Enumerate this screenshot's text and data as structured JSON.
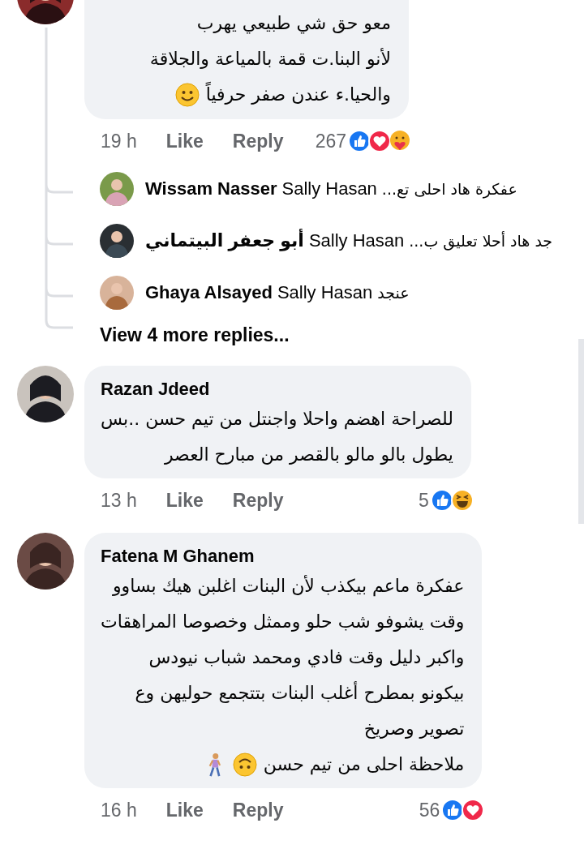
{
  "comments": [
    {
      "lines": [
        "معو حق شي طبيعي يهرب",
        "لأنو البنا.ت قمة بالمياعة والجلاقة",
        "والحيا.ء عندن صفر حرفياً"
      ],
      "emoji": [
        {
          "kind": "smile"
        }
      ],
      "time": "19 h",
      "like": "Like",
      "reply": "Reply",
      "reaction_count": "267",
      "reactions": [
        {
          "kind": "like"
        },
        {
          "kind": "love"
        },
        {
          "kind": "care"
        }
      ],
      "replies": [
        {
          "name": "Wissam Nasser",
          "mention": "Sally Hasan",
          "text": "عفكرة هاد احلى تع..."
        },
        {
          "name": "أبو جعفر البيتماني",
          "mention": "Sally Hasan",
          "text": "جد هاد أحلا تعليق ب..."
        },
        {
          "name": "Ghaya Alsayed",
          "mention": "Sally Hasan",
          "text": "عنجد"
        }
      ],
      "more_replies": "View 4 more replies..."
    },
    {
      "name": "Razan Jdeed",
      "lines": [
        "للصراحة اهضم واحلا واجنتل من تيم حسن ..بس",
        "يطول بالو مالو بالقصر من مبارح العصر"
      ],
      "time": "13 h",
      "like": "Like",
      "reply": "Reply",
      "reaction_count": "5",
      "reactions": [
        {
          "kind": "like"
        },
        {
          "kind": "haha"
        }
      ]
    },
    {
      "name": "Fatena M Ghanem",
      "lines": [
        "عفكرة ماعم بيكذب لأن البنات اغلبن هيك بساوو",
        "وقت يشوفو شب حلو وممثل وخصوصا المراهقات",
        "واكبر دليل وقت فادي ومحمد شباب نيودس",
        "بيكونو بمطرح أغلب البنات بتتجمع حوليهن وع",
        "تصوير وصريخ",
        "ملاحظة احلى من تيم حسن"
      ],
      "emoji": [
        {
          "kind": "upside_down"
        },
        {
          "kind": "walker"
        }
      ],
      "time": "16 h",
      "like": "Like",
      "reply": "Reply",
      "reaction_count": "56",
      "reactions": [
        {
          "kind": "like"
        },
        {
          "kind": "love"
        }
      ]
    }
  ]
}
